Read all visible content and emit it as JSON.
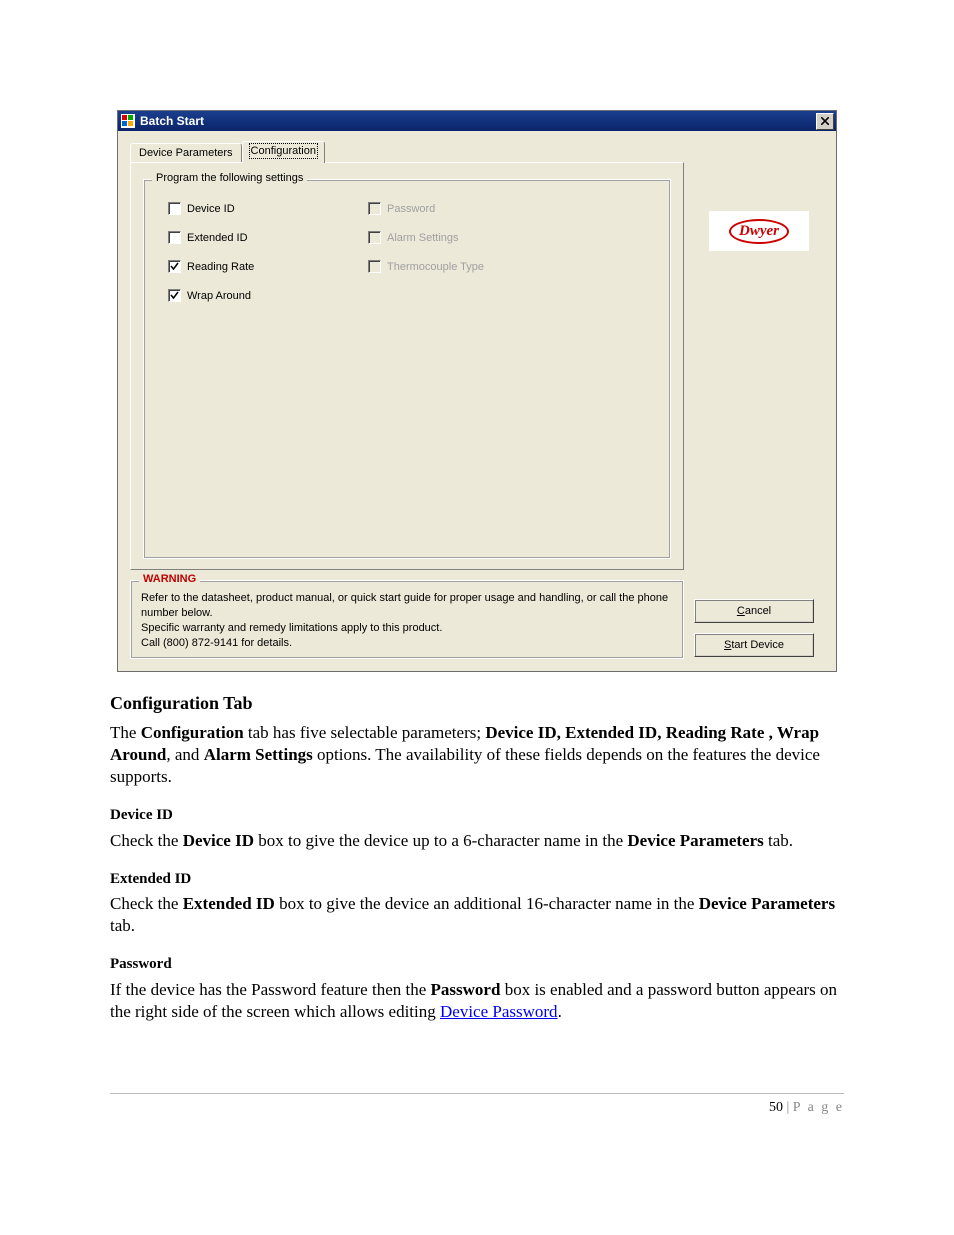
{
  "window": {
    "title": "Batch Start",
    "tabs": {
      "device_parameters": "Device Parameters",
      "configuration": "Configuration"
    },
    "groupbox_legend": "Program the following settings",
    "checkboxes": {
      "device_id": {
        "label": "Device ID",
        "checked": false,
        "enabled": true
      },
      "password": {
        "label": "Password",
        "checked": false,
        "enabled": false
      },
      "extended_id": {
        "label": "Extended ID",
        "checked": false,
        "enabled": true
      },
      "alarm_settings": {
        "label": "Alarm Settings",
        "checked": false,
        "enabled": false
      },
      "reading_rate": {
        "label": "Reading Rate",
        "checked": true,
        "enabled": true
      },
      "thermocouple_type": {
        "label": "Thermocouple Type",
        "checked": false,
        "enabled": false
      },
      "wrap_around": {
        "label": "Wrap Around",
        "checked": true,
        "enabled": true
      }
    },
    "logo_text": "Dwyer",
    "warning": {
      "legend": "WARNING",
      "line1": "Refer to the datasheet, product manual, or quick start guide for proper usage and handling, or call the phone number below.",
      "line2": "Specific warranty and remedy limitations apply to this product.",
      "line3": "Call (800) 872-9141 for details."
    },
    "buttons": {
      "cancel_pre": "",
      "cancel_u": "C",
      "cancel_post": "ancel",
      "start_pre": "",
      "start_u": "S",
      "start_post": "tart Device"
    }
  },
  "doc": {
    "h_config_tab": "Configuration Tab",
    "p_config_1a": "The ",
    "p_config_1b": "Configuration",
    "p_config_1c": " tab has five selectable parameters; ",
    "p_config_1d": "Device ID, Extended ID, Reading Rate , Wrap Around",
    "p_config_1e": ", and ",
    "p_config_1f": "Alarm Settings",
    "p_config_1g": " options. The availability of these fields depends on the features the device supports.",
    "h_device_id": "Device ID",
    "p_device_id_a": "Check the ",
    "p_device_id_b": "Device ID",
    "p_device_id_c": " box to give the device up to a 6-character name in the ",
    "p_device_id_d": "Device Parameters",
    "p_device_id_e": " tab.",
    "h_extended_id": "Extended ID",
    "p_extended_id_a": "Check the ",
    "p_extended_id_b": "Extended ID",
    "p_extended_id_c": " box to give the device an additional 16-character name in the ",
    "p_extended_id_d": "Device Parameters",
    "p_extended_id_e": " tab.",
    "h_password": "Password",
    "p_password_a": "If the device has the Password feature then the ",
    "p_password_b": "Password",
    "p_password_c": " box is enabled and a password button appears on the right side of the screen which allows editing ",
    "p_password_link": "Device Password",
    "p_password_d": ".",
    "footer_num": "50",
    "footer_sep": " | ",
    "footer_label": "P a g e"
  }
}
